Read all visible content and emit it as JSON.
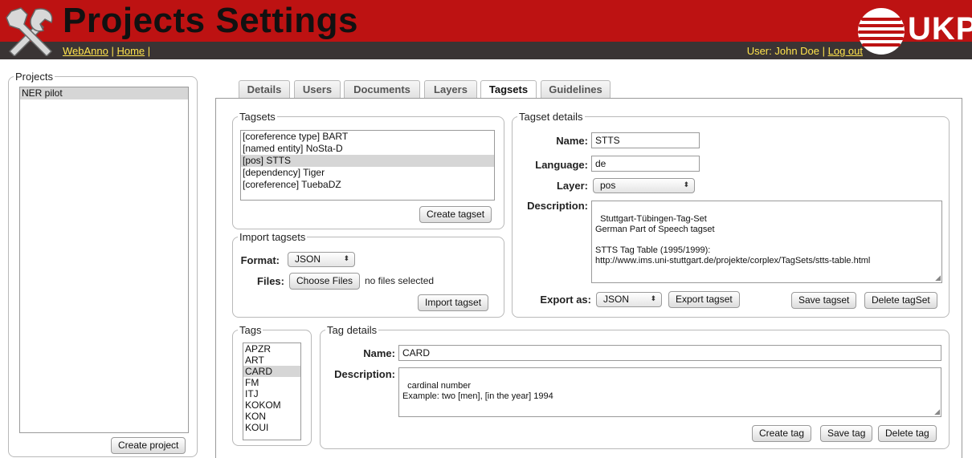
{
  "header": {
    "title": "Projects Settings",
    "links": {
      "webanno": "WebAnno",
      "separator1": " | ",
      "home": "Home",
      "separator2": " |"
    },
    "user_label": "User: John Doe",
    "user_separator": " | ",
    "logout": "Log out",
    "brand_text": "UKP",
    "colors": {
      "bar": "#bd1212",
      "strip": "#3a3434",
      "link": "#ffe34d"
    }
  },
  "projects": {
    "legend": "Projects",
    "items": [
      "NER pilot"
    ],
    "create_button": "Create project"
  },
  "tabs": [
    "Details",
    "Users",
    "Documents",
    "Layers",
    "Tagsets",
    "Guidelines"
  ],
  "active_tab": "Tagsets",
  "tagsets": {
    "legend": "Tagsets",
    "items": [
      "[coreference type] BART",
      "[named entity] NoSta-D",
      "[pos] STTS",
      "[dependency] Tiger",
      "[coreference] TuebaDZ"
    ],
    "selected_index": 2,
    "create_button": "Create tagset"
  },
  "import_tagsets": {
    "legend": "Import tagsets",
    "format_label": "Format:",
    "format_value": "JSON",
    "files_label": "Files:",
    "choose_button": "Choose Files",
    "files_status": "no files selected",
    "import_button": "Import tagset"
  },
  "tagset_details": {
    "legend": "Tagset details",
    "name_label": "Name:",
    "name_value": "STTS",
    "language_label": "Language:",
    "language_value": "de",
    "layer_label": "Layer:",
    "layer_value": "pos",
    "description_label": "Description:",
    "description_value": "Stuttgart-Tübingen-Tag-Set\nGerman Part of Speech tagset\n\nSTTS Tag Table (1995/1999):\nhttp://www.ims.uni-stuttgart.de/projekte/corplex/TagSets/stts-table.html",
    "export_label": "Export as:",
    "export_value": "JSON",
    "export_button": "Export tagset",
    "save_button": "Save tagset",
    "delete_button": "Delete tagSet"
  },
  "tags": {
    "legend": "Tags",
    "items": [
      "APZR",
      "ART",
      "CARD",
      "FM",
      "ITJ",
      "KOKOM",
      "KON",
      "KOUI"
    ],
    "selected_index": 2
  },
  "tag_details": {
    "legend": "Tag details",
    "name_label": "Name:",
    "name_value": "CARD",
    "description_label": "Description:",
    "description_value": "cardinal number\nExample: two [men], [in the year] 1994",
    "create_button": "Create tag",
    "save_button": "Save tag",
    "delete_button": "Delete tag"
  }
}
